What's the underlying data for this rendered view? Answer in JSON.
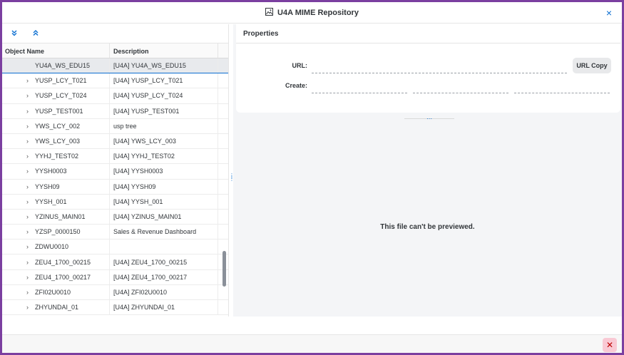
{
  "window": {
    "title": "U4A MIME Repository",
    "title_icon": "image-icon",
    "close_glyph": "×"
  },
  "toolbar": {
    "expand_all_glyph": "⌄",
    "collapse_all_glyph": "⌃"
  },
  "table": {
    "headers": {
      "object_name": "Object Name",
      "description": "Description"
    },
    "rows": [
      {
        "name": "YU4A_WS_EDU15",
        "desc": "[U4A] YU4A_WS_EDU15",
        "chevron": "",
        "selected": true
      },
      {
        "name": "YUSP_LCY_T021",
        "desc": "[U4A] YUSP_LCY_T021",
        "chevron": "›"
      },
      {
        "name": "YUSP_LCY_T024",
        "desc": "[U4A] YUSP_LCY_T024",
        "chevron": "›"
      },
      {
        "name": "YUSP_TEST001",
        "desc": "[U4A] YUSP_TEST001",
        "chevron": "›"
      },
      {
        "name": "YWS_LCY_002",
        "desc": "usp tree",
        "chevron": "›"
      },
      {
        "name": "YWS_LCY_003",
        "desc": "[U4A] YWS_LCY_003",
        "chevron": "›"
      },
      {
        "name": "YYHJ_TEST02",
        "desc": "[U4A] YYHJ_TEST02",
        "chevron": "›"
      },
      {
        "name": "YYSH0003",
        "desc": "[U4A] YYSH0003",
        "chevron": "›"
      },
      {
        "name": "YYSH09",
        "desc": "[U4A] YYSH09",
        "chevron": "›"
      },
      {
        "name": "YYSH_001",
        "desc": "[U4A] YYSH_001",
        "chevron": "›"
      },
      {
        "name": "YZINUS_MAIN01",
        "desc": "[U4A] YZINUS_MAIN01",
        "chevron": "›"
      },
      {
        "name": "YZSP_0000150",
        "desc": "Sales & Revenue Dashboard",
        "chevron": "›"
      },
      {
        "name": "ZDWU0010",
        "desc": "",
        "chevron": "›"
      },
      {
        "name": "ZEU4_1700_00215",
        "desc": "[U4A] ZEU4_1700_00215",
        "chevron": "›"
      },
      {
        "name": "ZEU4_1700_00217",
        "desc": "[U4A] ZEU4_1700_00217",
        "chevron": "›"
      },
      {
        "name": "ZFI02U0010",
        "desc": "[U4A] ZFI02U0010",
        "chevron": "›"
      },
      {
        "name": "ZHYUNDAI_01",
        "desc": "[U4A] ZHYUNDAI_01",
        "chevron": "›"
      }
    ]
  },
  "properties": {
    "title": "Properties",
    "url_label": "URL:",
    "create_label": "Create:",
    "url_copy_button": "URL Copy"
  },
  "preview": {
    "message": "This file can't be previewed."
  },
  "footer": {
    "close_glyph": "✕"
  },
  "colors": {
    "accent": "#0a6ed1",
    "frame": "#7b3fa0",
    "selected_row": "#e8eaed",
    "close_button_bg": "#f9c9d4"
  }
}
